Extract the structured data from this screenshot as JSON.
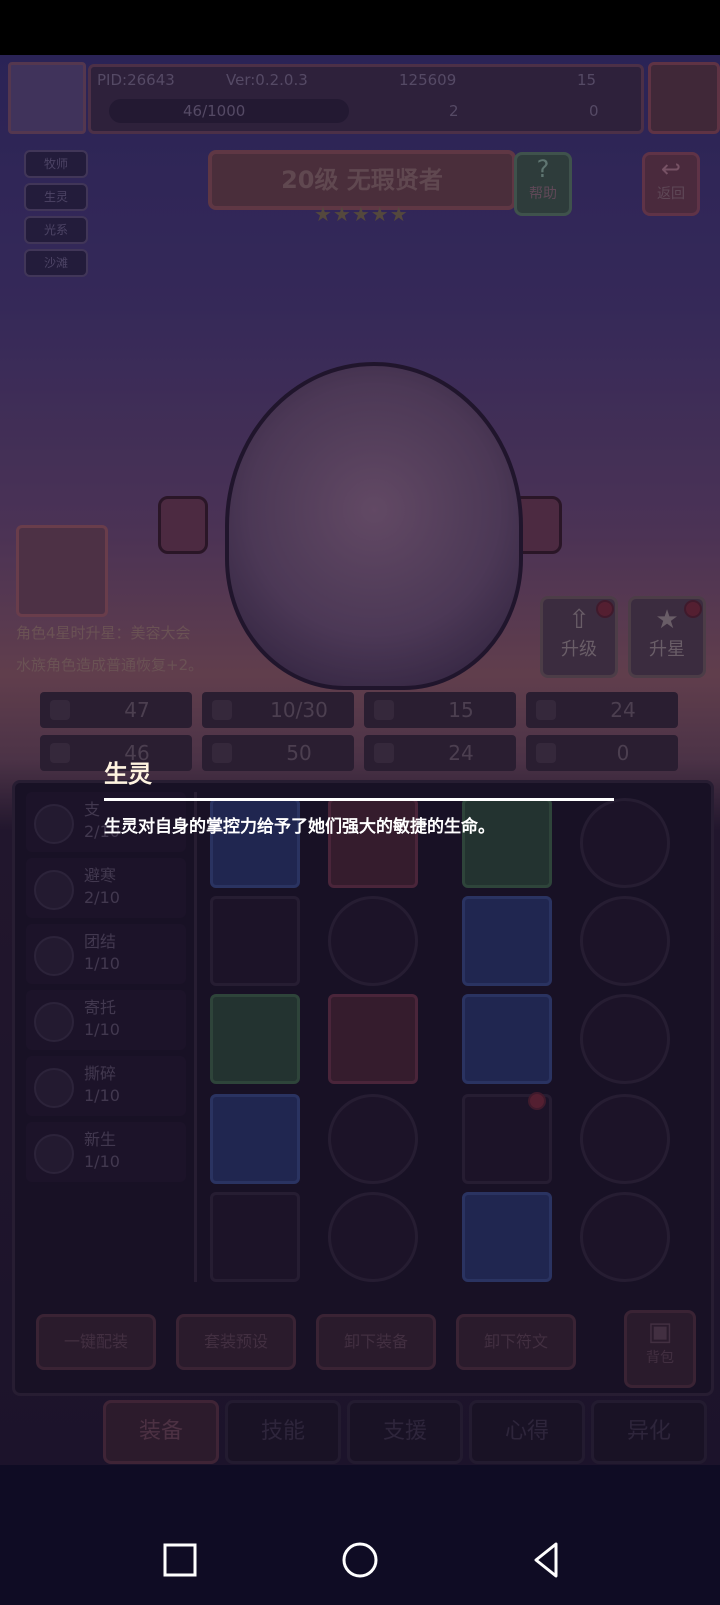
{
  "status": {
    "pid": "PID:26643",
    "version": "Ver:0.2.0.3",
    "exp": "46/1000",
    "currency_main": "125609",
    "gems": "15",
    "clover": "2",
    "key": "0"
  },
  "tags": [
    "牧师",
    "生灵",
    "光系",
    "沙滩"
  ],
  "character": {
    "title": "20级 无瑕贤者",
    "stars": 5,
    "help_label": "帮助",
    "back_label": "返回",
    "promo_line1": "角色4星时升星：美容大会",
    "promo_line2": "水族角色造成普通恢复+2。",
    "upgrade_label": "升级",
    "star_up_label": "升星"
  },
  "stats": [
    "47",
    "10/30",
    "15",
    "24",
    "46",
    "50",
    "24",
    "0"
  ],
  "skills": [
    {
      "name": "支",
      "level": "2/10"
    },
    {
      "name": "避寒",
      "level": "2/10"
    },
    {
      "name": "团结",
      "level": "1/10"
    },
    {
      "name": "寄托",
      "level": "1/10"
    },
    {
      "name": "撕碎",
      "level": "1/10"
    },
    {
      "name": "新生",
      "level": "1/10"
    }
  ],
  "panel_buttons": [
    "一键配装",
    "套装预设",
    "卸下装备",
    "卸下符文"
  ],
  "bag_label": "背包",
  "tabs": [
    "装备",
    "技能",
    "支援",
    "心得",
    "异化"
  ],
  "tooltip": {
    "title": "生灵",
    "description": "生灵对自身的掌控力给予了她们强大的敏捷的生命。"
  }
}
